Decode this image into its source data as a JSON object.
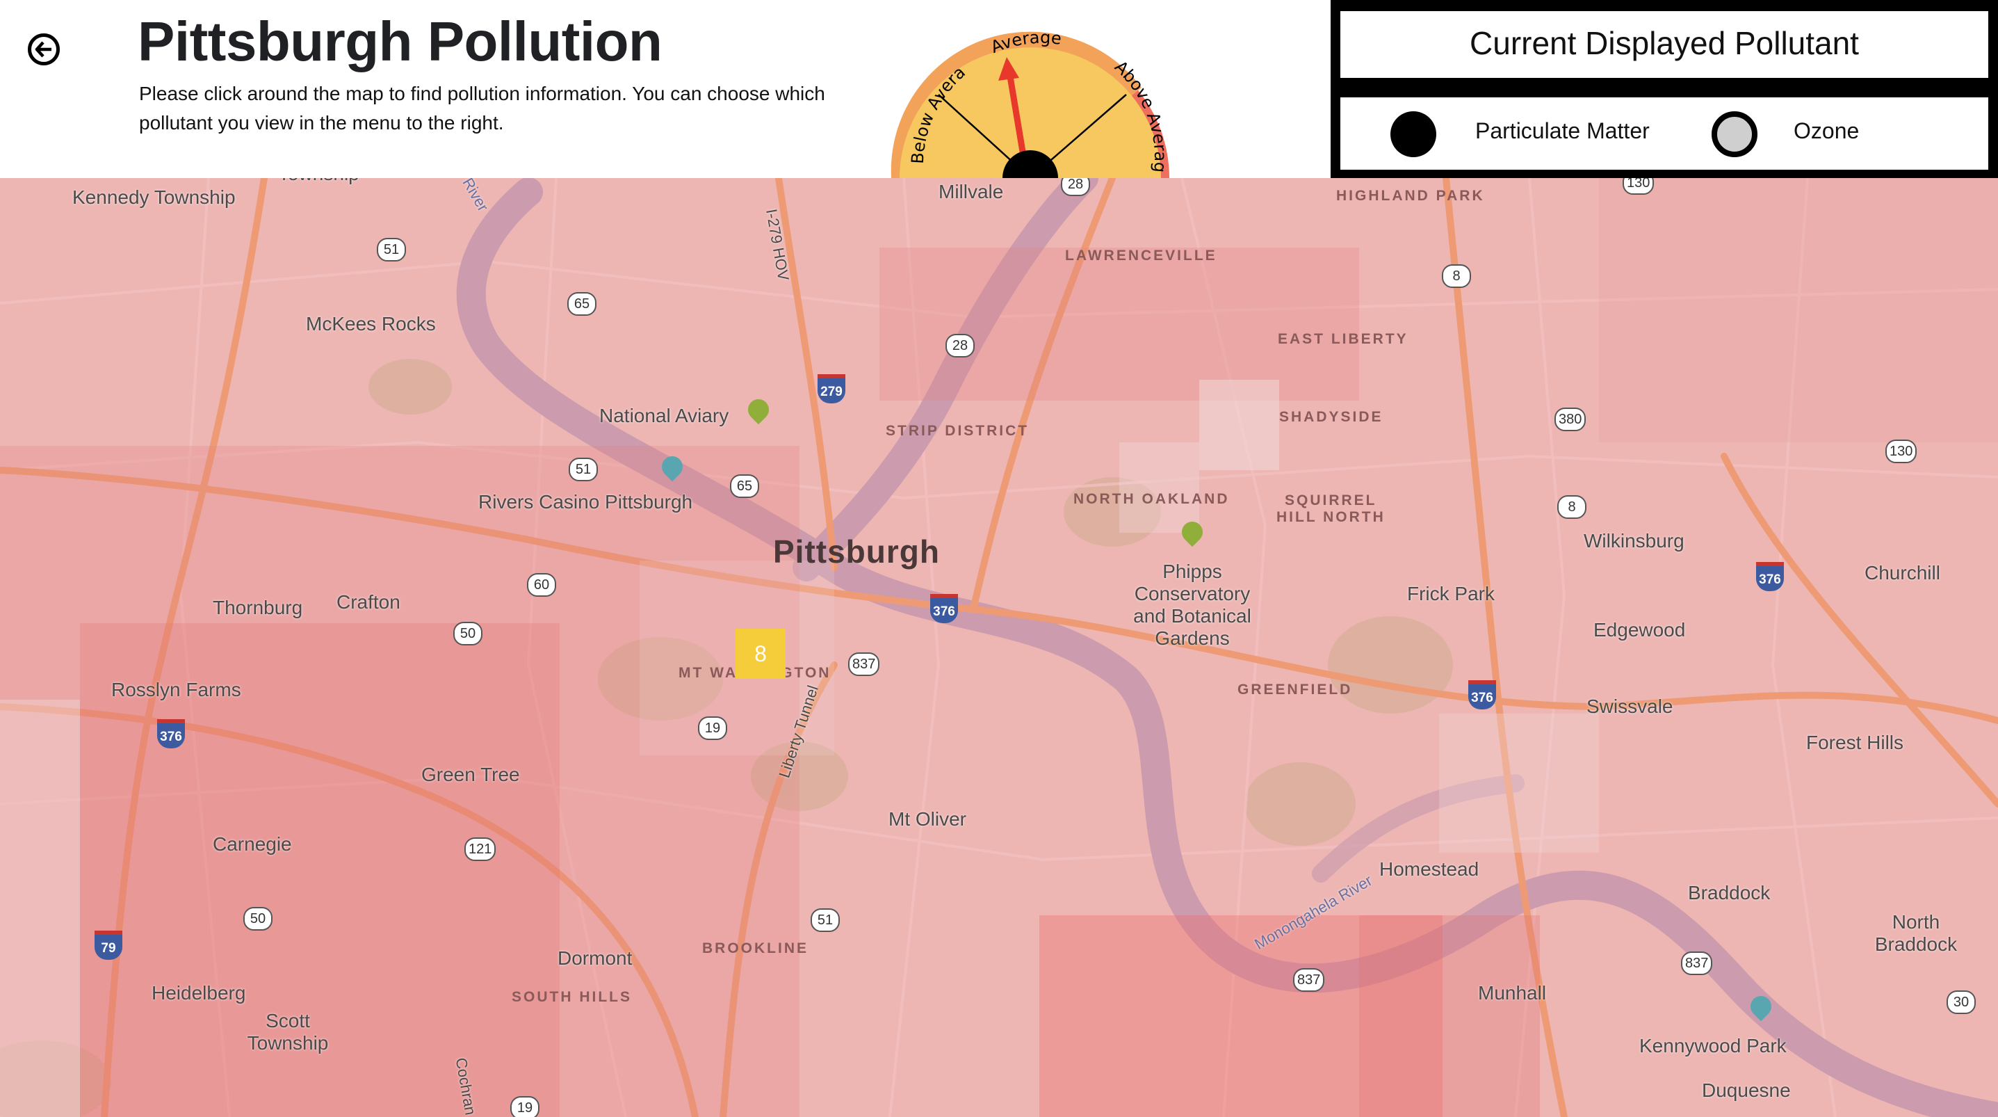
{
  "header": {
    "title": "Pittsburgh Pollution",
    "instructions": "Please click around the map to find pollution information. You can choose which pollutant you view in the menu to the right."
  },
  "gauge": {
    "labels": {
      "low": "Below Average",
      "mid": "Average",
      "high": "Above Average"
    },
    "needle_level": "Average",
    "colors": {
      "low": "#f6c85f",
      "mid": "#f6c85f",
      "high": "#ef6f5e",
      "needle": "#e8382b"
    }
  },
  "pollutant_panel": {
    "title": "Current Displayed Pollutant",
    "options": [
      {
        "label": "Particulate Matter",
        "selected": true
      },
      {
        "label": "Ozone",
        "selected": false
      }
    ]
  },
  "map": {
    "city_label": "Pittsburgh",
    "cluster_count": "8",
    "places": {
      "kennedy": "Kennedy Township",
      "millvale": "Millvale",
      "mckees": "McKees Rocks",
      "aviary": "National Aviary",
      "rivers": "Rivers Casino Pittsburgh",
      "thornburg": "Thornburg",
      "crafton": "Crafton",
      "rosslyn": "Rosslyn Farms",
      "greentree": "Green Tree",
      "carnegie": "Carnegie",
      "dormont": "Dormont",
      "heidelberg": "Heidelberg",
      "scott": "Scott Township",
      "mtoliver": "Mt Oliver",
      "phipps": "Phipps Conservatory and Botanical Gardens",
      "frickpark": "Frick Park",
      "wilkinsburg": "Wilkinsburg",
      "churchill": "Churchill",
      "edgewood": "Edgewood",
      "swissvale": "Swissvale",
      "foresthills": "Forest Hills",
      "homestead": "Homestead",
      "braddock": "Braddock",
      "northbraddock": "North Braddock",
      "munhall": "Munhall",
      "kennywood": "Kennywood Park",
      "duquesne": "Duquesne",
      "township_top": "Township"
    },
    "neighborhoods": {
      "highland": "HIGHLAND PARK",
      "lawrenceville": "LAWRENCEVILLE",
      "eastliberty": "EAST LIBERTY",
      "shadyside": "SHADYSIDE",
      "strip": "STRIP DISTRICT",
      "northoakland": "NORTH OAKLAND",
      "squirrel1": "SQUIRREL",
      "squirrel2": "HILL NORTH",
      "mtwash": "MT WASHINGTON",
      "greenfield": "GREENFIELD",
      "brookline": "BROOKLINE",
      "southhills": "SOUTH HILLS"
    },
    "roads": {
      "i279": "I-279 HOV",
      "liberty": "Liberty Tunnel",
      "mon": "Monongahela River",
      "river_top": "River",
      "cochran": "Cochran"
    },
    "shields": [
      "51",
      "65",
      "28",
      "8",
      "130",
      "380",
      "130",
      "8",
      "51",
      "60",
      "50",
      "837",
      "19",
      "121",
      "50",
      "51",
      "837",
      "837",
      "30",
      "65",
      "19",
      "28"
    ],
    "interstates": [
      "279",
      "376",
      "376",
      "376",
      "376",
      "79"
    ]
  }
}
